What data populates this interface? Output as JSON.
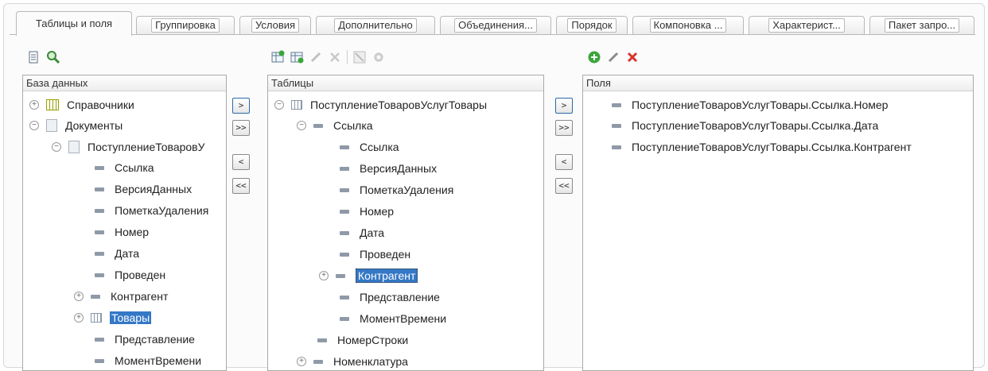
{
  "tabs": [
    {
      "label": "Таблицы и поля"
    },
    {
      "label": "Группировка"
    },
    {
      "label": "Условия"
    },
    {
      "label": "Дополнительно"
    },
    {
      "label": "Объединения..."
    },
    {
      "label": "Порядок"
    },
    {
      "label": "Компоновка ..."
    },
    {
      "label": "Характерист..."
    },
    {
      "label": "Пакет запро..."
    }
  ],
  "colors": {
    "selection": "#3478c6",
    "accent_green": "#3aa63a",
    "delete_red": "#d9342b"
  },
  "database": {
    "header": "База данных",
    "rows": [
      {
        "text": "Справочники",
        "exp": "+",
        "icon": "catalog-icon"
      },
      {
        "text": "Документы",
        "exp": "−",
        "icon": "document-icon"
      },
      {
        "text": "ПоступлениеТоваровУ",
        "exp": "−",
        "icon": "document-icon"
      },
      {
        "text": "Ссылка",
        "icon": "field-icon"
      },
      {
        "text": "ВерсияДанных",
        "icon": "field-icon"
      },
      {
        "text": "ПометкаУдаления",
        "icon": "field-icon"
      },
      {
        "text": "Номер",
        "icon": "field-icon"
      },
      {
        "text": "Дата",
        "icon": "field-icon"
      },
      {
        "text": "Проведен",
        "icon": "field-icon"
      },
      {
        "text": "Контрагент",
        "exp": "+",
        "icon": "field-icon"
      },
      {
        "text": "Товары",
        "exp": "+",
        "icon": "table-icon",
        "selected": true
      },
      {
        "text": "Представление",
        "icon": "field-icon"
      },
      {
        "text": "МоментВремени",
        "icon": "field-icon"
      }
    ]
  },
  "tables": {
    "header": "Таблицы",
    "rows": [
      {
        "text": "ПоступлениеТоваровУслугТовары",
        "exp": "−",
        "icon": "table-icon"
      },
      {
        "text": "Ссылка",
        "exp": "−",
        "icon": "field-icon"
      },
      {
        "text": "Ссылка",
        "icon": "field-icon"
      },
      {
        "text": "ВерсияДанных",
        "icon": "field-icon"
      },
      {
        "text": "ПометкаУдаления",
        "icon": "field-icon"
      },
      {
        "text": "Номер",
        "icon": "field-icon"
      },
      {
        "text": "Дата",
        "icon": "field-icon"
      },
      {
        "text": "Проведен",
        "icon": "field-icon"
      },
      {
        "text": "Контрагент",
        "exp": "+",
        "icon": "field-icon",
        "selected": true
      },
      {
        "text": "Представление",
        "icon": "field-icon"
      },
      {
        "text": "МоментВремени",
        "icon": "field-icon"
      },
      {
        "text": "НомерСтроки",
        "icon": "field-icon"
      },
      {
        "text": "Номенклатура",
        "exp": "+",
        "icon": "field-icon"
      }
    ]
  },
  "fields": {
    "header": "Поля",
    "rows": [
      {
        "text": "ПоступлениеТоваровУслугТовары.Ссылка.Номер",
        "icon": "field-icon"
      },
      {
        "text": "ПоступлениеТоваровУслугТовары.Ссылка.Дата",
        "icon": "field-icon"
      },
      {
        "text": "ПоступлениеТоваровУслугТовары.Ссылка.Контрагент",
        "icon": "field-icon"
      }
    ]
  },
  "move_buttons": {
    "add": ">",
    "add_all": ">>",
    "remove": "<",
    "remove_all": "<<"
  }
}
